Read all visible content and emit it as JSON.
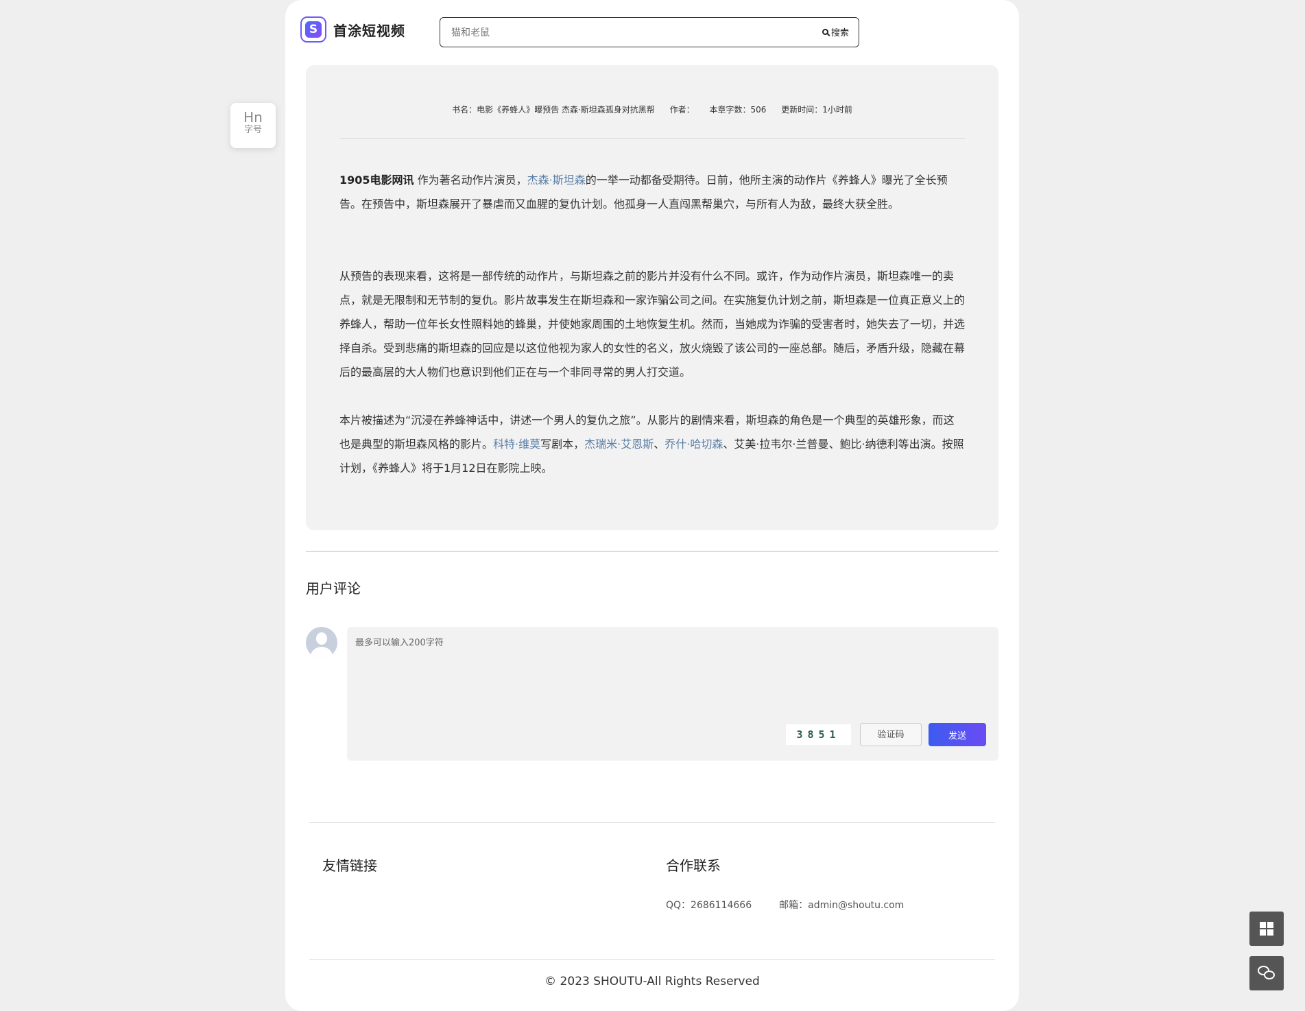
{
  "header": {
    "logo_text": "首涂短视频",
    "search_value": "猫和老鼠",
    "search_button": "搜索"
  },
  "fontsize_widget": {
    "glyph": "Hn",
    "label": "字号"
  },
  "article": {
    "meta": {
      "book": "书名：电影《养蜂人》曝预告 杰森·斯坦森孤身对抗黑帮",
      "author": "作者：",
      "word_count": "本章字数：506",
      "updated": "更新时间：1小时前"
    },
    "p1_source": "1905电影网讯",
    "p1_text_a": " 作为著名动作片演员，",
    "p1_link": "杰森·斯坦森",
    "p1_text_b": "的一举一动都备受期待。日前，他所主演的动作片《养蜂人》曝光了全长预告。在预告中，斯坦森展开了暴虐而又血腥的复仇计划。他孤身一人直闯黑帮巢穴，与所有人为敌，最终大获全胜。",
    "p2": "从预告的表现来看，这将是一部传统的动作片，与斯坦森之前的影片并没有什么不同。或许，作为动作片演员，斯坦森唯一的卖点，就是无限制和无节制的复仇。影片故事发生在斯坦森和一家诈骗公司之间。在实施复仇计划之前，斯坦森是一位真正意义上的养蜂人，帮助一位年长女性照料她的蜂巢，并使她家周围的土地恢复生机。然而，当她成为诈骗的受害者时，她失去了一切，并选择自杀。受到悲痛的斯坦森的回应是以这位他视为家人的女性的名义，放火烧毁了该公司的一座总部。随后，矛盾升级，隐藏在幕后的最高层的大人物们也意识到他们正在与一个非同寻常的男人打交道。",
    "p3_text_a": "本片被描述为“沉浸在养蜂神话中，讲述一个男人的复仇之旅”。从影片的剧情来看，斯坦森的角色是一个典型的英雄形象，而这也是典型的斯坦森风格的影片。",
    "p3_link1": "科特·维莫",
    "p3_text_b": "写剧本，",
    "p3_link2": "杰瑞米·艾恩斯",
    "p3_sep1": "、",
    "p3_link3": "乔什·哈切森",
    "p3_text_c": "、艾美·拉韦尔·兰普曼、鲍比·纳德利等出演。按照计划，《养蜂人》将于1月12日在影院上映。"
  },
  "comments": {
    "title": "用户评论",
    "placeholder": "最多可以输入200字符",
    "captcha_text": "3851",
    "captcha_placeholder": "验证码",
    "send_label": "发送"
  },
  "footer": {
    "links_title": "友情链接",
    "contact_title": "合作联系",
    "qq": "QQ：2686114666",
    "email": "邮箱：admin@shoutu.com",
    "copyright": "© 2023 SHOUTU-All Rights Reserved"
  },
  "colors": {
    "accent": "#4b5bf0",
    "link": "#5b7ea6",
    "float_button": "#555555"
  },
  "icons": [
    "logo-mark-icon",
    "search-icon",
    "windows-icon",
    "wechat-icon"
  ]
}
